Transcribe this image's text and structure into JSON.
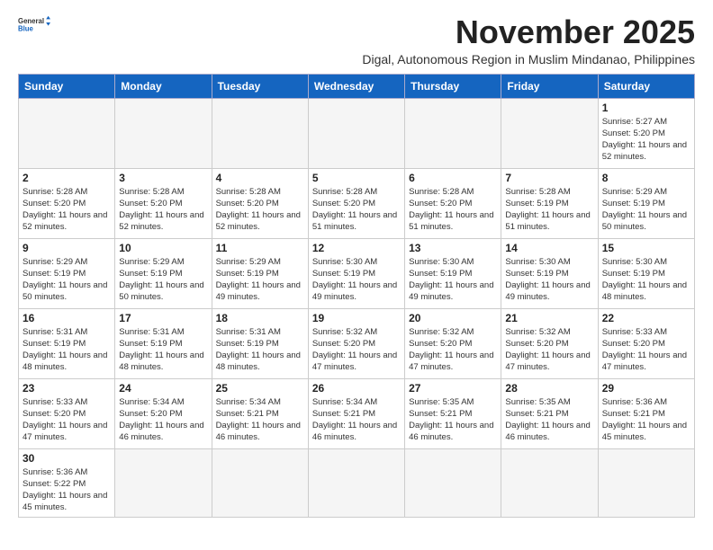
{
  "header": {
    "logo_general": "General",
    "logo_blue": "Blue",
    "month_title": "November 2025",
    "subtitle": "Digal, Autonomous Region in Muslim Mindanao, Philippines"
  },
  "weekdays": [
    "Sunday",
    "Monday",
    "Tuesday",
    "Wednesday",
    "Thursday",
    "Friday",
    "Saturday"
  ],
  "weeks": [
    [
      {
        "day": "",
        "empty": true
      },
      {
        "day": "",
        "empty": true
      },
      {
        "day": "",
        "empty": true
      },
      {
        "day": "",
        "empty": true
      },
      {
        "day": "",
        "empty": true
      },
      {
        "day": "",
        "empty": true
      },
      {
        "day": "1",
        "sunrise": "Sunrise: 5:27 AM",
        "sunset": "Sunset: 5:20 PM",
        "daylight": "Daylight: 11 hours and 52 minutes."
      }
    ],
    [
      {
        "day": "2",
        "sunrise": "Sunrise: 5:28 AM",
        "sunset": "Sunset: 5:20 PM",
        "daylight": "Daylight: 11 hours and 52 minutes."
      },
      {
        "day": "3",
        "sunrise": "Sunrise: 5:28 AM",
        "sunset": "Sunset: 5:20 PM",
        "daylight": "Daylight: 11 hours and 52 minutes."
      },
      {
        "day": "4",
        "sunrise": "Sunrise: 5:28 AM",
        "sunset": "Sunset: 5:20 PM",
        "daylight": "Daylight: 11 hours and 52 minutes."
      },
      {
        "day": "5",
        "sunrise": "Sunrise: 5:28 AM",
        "sunset": "Sunset: 5:20 PM",
        "daylight": "Daylight: 11 hours and 51 minutes."
      },
      {
        "day": "6",
        "sunrise": "Sunrise: 5:28 AM",
        "sunset": "Sunset: 5:20 PM",
        "daylight": "Daylight: 11 hours and 51 minutes."
      },
      {
        "day": "7",
        "sunrise": "Sunrise: 5:28 AM",
        "sunset": "Sunset: 5:19 PM",
        "daylight": "Daylight: 11 hours and 51 minutes."
      },
      {
        "day": "8",
        "sunrise": "Sunrise: 5:29 AM",
        "sunset": "Sunset: 5:19 PM",
        "daylight": "Daylight: 11 hours and 50 minutes."
      }
    ],
    [
      {
        "day": "9",
        "sunrise": "Sunrise: 5:29 AM",
        "sunset": "Sunset: 5:19 PM",
        "daylight": "Daylight: 11 hours and 50 minutes."
      },
      {
        "day": "10",
        "sunrise": "Sunrise: 5:29 AM",
        "sunset": "Sunset: 5:19 PM",
        "daylight": "Daylight: 11 hours and 50 minutes."
      },
      {
        "day": "11",
        "sunrise": "Sunrise: 5:29 AM",
        "sunset": "Sunset: 5:19 PM",
        "daylight": "Daylight: 11 hours and 49 minutes."
      },
      {
        "day": "12",
        "sunrise": "Sunrise: 5:30 AM",
        "sunset": "Sunset: 5:19 PM",
        "daylight": "Daylight: 11 hours and 49 minutes."
      },
      {
        "day": "13",
        "sunrise": "Sunrise: 5:30 AM",
        "sunset": "Sunset: 5:19 PM",
        "daylight": "Daylight: 11 hours and 49 minutes."
      },
      {
        "day": "14",
        "sunrise": "Sunrise: 5:30 AM",
        "sunset": "Sunset: 5:19 PM",
        "daylight": "Daylight: 11 hours and 49 minutes."
      },
      {
        "day": "15",
        "sunrise": "Sunrise: 5:30 AM",
        "sunset": "Sunset: 5:19 PM",
        "daylight": "Daylight: 11 hours and 48 minutes."
      }
    ],
    [
      {
        "day": "16",
        "sunrise": "Sunrise: 5:31 AM",
        "sunset": "Sunset: 5:19 PM",
        "daylight": "Daylight: 11 hours and 48 minutes."
      },
      {
        "day": "17",
        "sunrise": "Sunrise: 5:31 AM",
        "sunset": "Sunset: 5:19 PM",
        "daylight": "Daylight: 11 hours and 48 minutes."
      },
      {
        "day": "18",
        "sunrise": "Sunrise: 5:31 AM",
        "sunset": "Sunset: 5:19 PM",
        "daylight": "Daylight: 11 hours and 48 minutes."
      },
      {
        "day": "19",
        "sunrise": "Sunrise: 5:32 AM",
        "sunset": "Sunset: 5:20 PM",
        "daylight": "Daylight: 11 hours and 47 minutes."
      },
      {
        "day": "20",
        "sunrise": "Sunrise: 5:32 AM",
        "sunset": "Sunset: 5:20 PM",
        "daylight": "Daylight: 11 hours and 47 minutes."
      },
      {
        "day": "21",
        "sunrise": "Sunrise: 5:32 AM",
        "sunset": "Sunset: 5:20 PM",
        "daylight": "Daylight: 11 hours and 47 minutes."
      },
      {
        "day": "22",
        "sunrise": "Sunrise: 5:33 AM",
        "sunset": "Sunset: 5:20 PM",
        "daylight": "Daylight: 11 hours and 47 minutes."
      }
    ],
    [
      {
        "day": "23",
        "sunrise": "Sunrise: 5:33 AM",
        "sunset": "Sunset: 5:20 PM",
        "daylight": "Daylight: 11 hours and 47 minutes."
      },
      {
        "day": "24",
        "sunrise": "Sunrise: 5:34 AM",
        "sunset": "Sunset: 5:20 PM",
        "daylight": "Daylight: 11 hours and 46 minutes."
      },
      {
        "day": "25",
        "sunrise": "Sunrise: 5:34 AM",
        "sunset": "Sunset: 5:21 PM",
        "daylight": "Daylight: 11 hours and 46 minutes."
      },
      {
        "day": "26",
        "sunrise": "Sunrise: 5:34 AM",
        "sunset": "Sunset: 5:21 PM",
        "daylight": "Daylight: 11 hours and 46 minutes."
      },
      {
        "day": "27",
        "sunrise": "Sunrise: 5:35 AM",
        "sunset": "Sunset: 5:21 PM",
        "daylight": "Daylight: 11 hours and 46 minutes."
      },
      {
        "day": "28",
        "sunrise": "Sunrise: 5:35 AM",
        "sunset": "Sunset: 5:21 PM",
        "daylight": "Daylight: 11 hours and 46 minutes."
      },
      {
        "day": "29",
        "sunrise": "Sunrise: 5:36 AM",
        "sunset": "Sunset: 5:21 PM",
        "daylight": "Daylight: 11 hours and 45 minutes."
      }
    ],
    [
      {
        "day": "30",
        "sunrise": "Sunrise: 5:36 AM",
        "sunset": "Sunset: 5:22 PM",
        "daylight": "Daylight: 11 hours and 45 minutes."
      },
      {
        "day": "",
        "empty": true
      },
      {
        "day": "",
        "empty": true
      },
      {
        "day": "",
        "empty": true
      },
      {
        "day": "",
        "empty": true
      },
      {
        "day": "",
        "empty": true
      },
      {
        "day": "",
        "empty": true
      }
    ]
  ]
}
